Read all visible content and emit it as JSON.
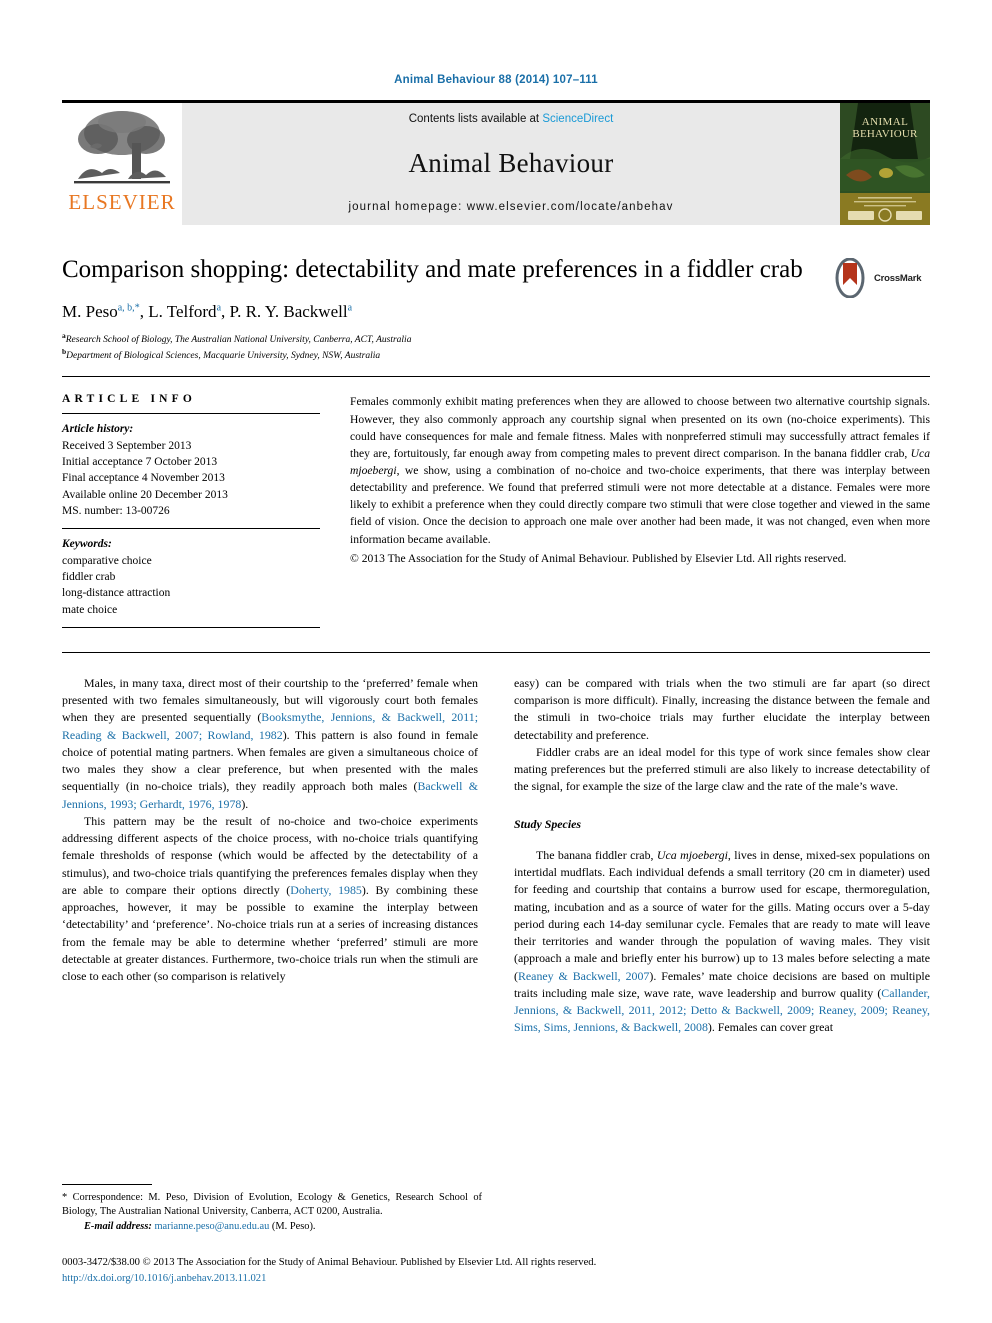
{
  "running_head": "Animal Behaviour 88 (2014) 107–111",
  "masthead": {
    "publisher_name": "ELSEVIER",
    "contents_prefix": "Contents lists available at ",
    "contents_link": "ScienceDirect",
    "journal_title": "Animal Behaviour",
    "homepage_prefix": "journal homepage: ",
    "homepage_url": "www.elsevier.com/locate/anbehav",
    "cover_title_line1": "ANIMAL",
    "cover_title_line2": "BEHAVIOUR"
  },
  "article": {
    "title": "Comparison shopping: detectability and mate preferences in a fiddler crab",
    "crossmark_label": "CrossMark",
    "authors_html": "M. Peso<sup>a, b,</sup><sup>*</sup>, L. Telford<sup>a</sup>, P. R. Y. Backwell<sup>a</sup>",
    "affiliations": [
      {
        "marker": "a",
        "text": "Research School of Biology, The Australian National University, Canberra, ACT, Australia"
      },
      {
        "marker": "b",
        "text": "Department of Biological Sciences, Macquarie University, Sydney, NSW, Australia"
      }
    ]
  },
  "article_info": {
    "heading": "ARTICLE INFO",
    "history_label": "Article history:",
    "history": [
      "Received 3 September 2013",
      "Initial acceptance 7 October 2013",
      "Final acceptance 4 November 2013",
      "Available online 20 December 2013",
      "MS. number: 13-00726"
    ],
    "keywords_label": "Keywords:",
    "keywords": [
      "comparative choice",
      "fiddler crab",
      "long-distance attraction",
      "mate choice"
    ]
  },
  "abstract": {
    "part1": "Females commonly exhibit mating preferences when they are allowed to choose between two alternative courtship signals. However, they also commonly approach any courtship signal when presented on its own (no-choice experiments). This could have consequences for male and female fitness. Males with nonpreferred stimuli may successfully attract females if they are, fortuitously, far enough away from competing males to prevent direct comparison. In the banana fiddler crab, ",
    "species": "Uca mjoebergi",
    "part2": ", we show, using a combination of no-choice and two-choice experiments, that there was interplay between detectability and preference. We found that preferred stimuli were not more detectable at a distance. Females were more likely to exhibit a preference when they could directly compare two stimuli that were close together and viewed in the same field of vision. Once the decision to approach one male over another had been made, it was not changed, even when more information became available.",
    "copyright": "© 2013 The Association for the Study of Animal Behaviour. Published by Elsevier Ltd. All rights reserved."
  },
  "body": {
    "left_column": [
      {
        "segments": [
          {
            "t": "Males, in many taxa, direct most of their courtship to the ‘preferred’ female when presented with two females simultaneously, but will vigorously court both females when they are presented sequentially ("
          },
          {
            "t": "Booksmythe, Jennions, & Backwell, 2011; Reading & Backwell, 2007; Rowland, 1982",
            "ref": true
          },
          {
            "t": "). This pattern is also found in female choice of potential mating partners. When females are given a simultaneous choice of two males they show a clear preference, but when presented with the males sequentially (in no-choice trials), they readily approach both males ("
          },
          {
            "t": "Backwell & Jennions, 1993; Gerhardt, 1976, 1978",
            "ref": true
          },
          {
            "t": ")."
          }
        ]
      },
      {
        "segments": [
          {
            "t": "This pattern may be the result of no-choice and two-choice experiments addressing different aspects of the choice process, with no-choice trials quantifying female thresholds of response (which would be affected by the detectability of a stimulus), and two-choice trials quantifying the preferences females display when they are able to compare their options directly ("
          },
          {
            "t": "Doherty, 1985",
            "ref": true
          },
          {
            "t": "). By combining these approaches, however, it may be possible to examine the interplay between ‘detectability’ and ‘preference’. No-choice trials run at a series of increasing distances from the female may be able to determine whether ‘preferred’ stimuli are more detectable at greater distances. Furthermore, two-choice trials run when the stimuli are close to each other (so comparison is relatively"
          }
        ]
      }
    ],
    "right_column": [
      {
        "noindent": true,
        "segments": [
          {
            "t": "easy) can be compared with trials when the two stimuli are far apart (so direct comparison is more difficult). Finally, increasing the distance between the female and the stimuli in two-choice trials may further elucidate the interplay between detectability and preference."
          }
        ]
      },
      {
        "segments": [
          {
            "t": "Fiddler crabs are an ideal model for this type of work since females show clear mating preferences but the preferred stimuli are also likely to increase detectability of the signal, for example the size of the large claw and the rate of the male’s wave."
          }
        ]
      }
    ],
    "section_heading": "Study Species",
    "right_column_after_heading": [
      {
        "segments": [
          {
            "t": "The banana fiddler crab, "
          },
          {
            "t": "Uca mjoebergi",
            "sp": true
          },
          {
            "t": ", lives in dense, mixed-sex populations on intertidal mudflats. Each individual defends a small territory (20 cm in diameter) used for feeding and courtship that contains a burrow used for escape, thermoregulation, mating, incubation and as a source of water for the gills. Mating occurs over a 5-day period during each 14-day semilunar cycle. Females that are ready to mate will leave their territories and wander through the population of waving males. They visit (approach a male and briefly enter his burrow) up to 13 males before selecting a mate ("
          },
          {
            "t": "Reaney & Backwell, 2007",
            "ref": true
          },
          {
            "t": "). Females’ mate choice decisions are based on multiple traits including male size, wave rate, wave leadership and burrow quality ("
          },
          {
            "t": "Callander, Jennions, & Backwell, 2011, 2012; Detto & Backwell, 2009; Reaney, 2009; Reaney, Sims, Sims, Jennions, & Backwell, 2008",
            "ref": true
          },
          {
            "t": "). Females can cover great"
          }
        ]
      }
    ]
  },
  "footnotes": {
    "correspondence": "* Correspondence: M. Peso, Division of Evolution, Ecology & Genetics, Research School of Biology, The Australian National University, Canberra, ACT 0200, Australia.",
    "email_label": "E-mail address: ",
    "email": "marianne.peso@anu.edu.au",
    "email_suffix": " (M. Peso)."
  },
  "page_footer": {
    "issn_line": "0003-3472/$38.00 © 2013 The Association for the Study of Animal Behaviour. Published by Elsevier Ltd. All rights reserved.",
    "doi": "http://dx.doi.org/10.1016/j.anbehav.2013.11.021"
  },
  "colors": {
    "link_blue": "#1a6fa8",
    "sciencedirect_blue": "#1a9ad6",
    "elsevier_orange": "#E87722",
    "band_gray": "#e9e9e9"
  }
}
